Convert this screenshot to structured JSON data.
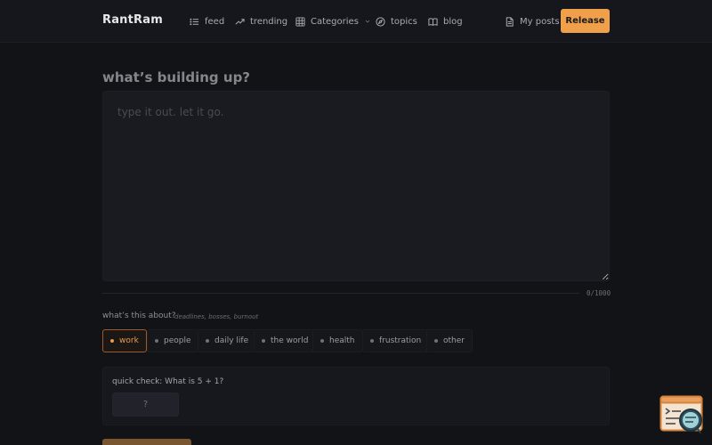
{
  "header": {
    "brand": "RantRam",
    "nav": [
      {
        "label": "feed",
        "icon": "list-icon"
      },
      {
        "label": "trending",
        "icon": "trending-up-icon"
      },
      {
        "label": "Categories",
        "icon": "grid-icon"
      },
      {
        "label": "topics",
        "icon": "compass-icon"
      },
      {
        "label": "blog",
        "icon": "book-icon"
      }
    ],
    "my_posts": "My posts",
    "release_label": "Release"
  },
  "composer": {
    "title": "what’s building up?",
    "placeholder": "type it out. let it go.",
    "value": "",
    "counter": "0/1000"
  },
  "topics": {
    "question": "what’s this about?",
    "hint": "deadlines, bosses, burnout",
    "selected": "work",
    "chips": [
      "work",
      "people",
      "daily life",
      "the world",
      "health",
      "frustration",
      "other"
    ]
  },
  "captcha": {
    "label": "quick check: What is 5 + 1?",
    "placeholder": "?",
    "value": ""
  },
  "colors": {
    "accent": "#f0a04a",
    "background": "#121317",
    "surface": "#1a1b20"
  }
}
